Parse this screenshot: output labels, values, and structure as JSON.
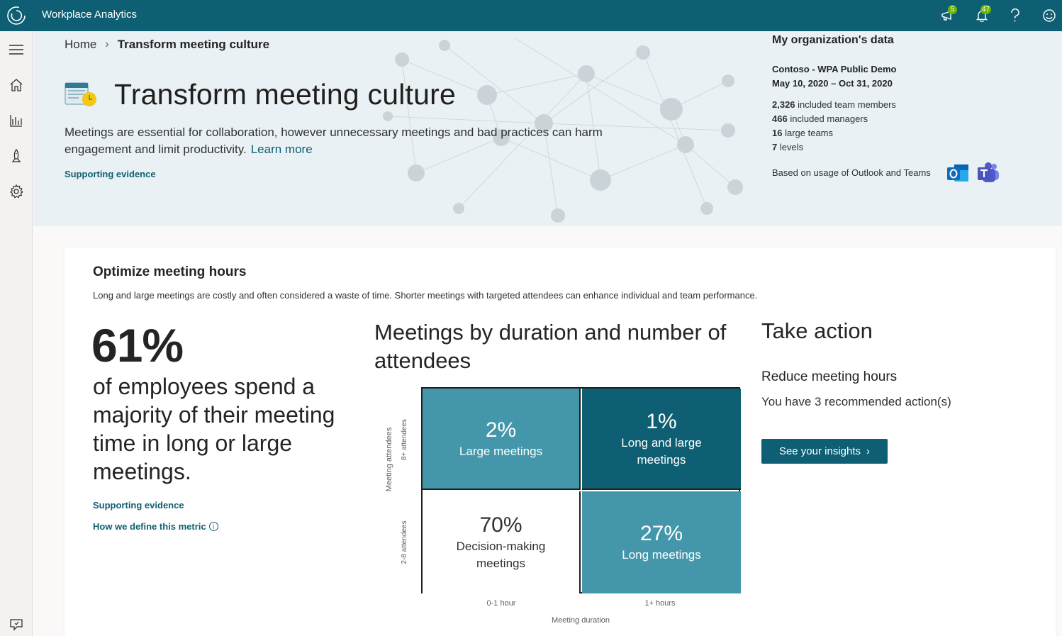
{
  "app": {
    "title": "Workplace Analytics",
    "accent_color": "#0e5f73",
    "badges": {
      "announcements": "5",
      "notifications": "47"
    }
  },
  "breadcrumb": {
    "home": "Home",
    "current": "Transform meeting culture"
  },
  "hero": {
    "title": "Transform meeting culture",
    "description": "Meetings are essential for collaboration, however unnecessary meetings and bad practices can harm engagement and limit productivity.",
    "learn_more": "Learn more",
    "supporting_evidence": "Supporting evidence"
  },
  "org": {
    "title": "My organization's data",
    "name": "Contoso - WPA Public Demo",
    "dates": "May 10, 2020 – Oct 31, 2020",
    "stats": [
      {
        "value": "2,326",
        "label": "included team members"
      },
      {
        "value": "466",
        "label": "included managers"
      },
      {
        "value": "16",
        "label": "large teams"
      },
      {
        "value": "7",
        "label": "levels"
      }
    ],
    "usage": "Based on usage of Outlook and Teams"
  },
  "card": {
    "title": "Optimize meeting hours",
    "description": "Long and large meetings are costly and often considered a waste of time. Shorter meetings with targeted attendees can enhance individual and team performance.",
    "big_pct": "61%",
    "big_text": "of employees spend a majority of their meeting time in long or large meetings.",
    "supporting_evidence": "Supporting evidence",
    "define_metric": "How we define this metric"
  },
  "chart_data": {
    "type": "heatmap",
    "title": "Meetings by duration and number of attendees",
    "xlabel": "Meeting duration",
    "ylabel": "Meeting attendees",
    "x_categories": [
      "0-1 hour",
      "1+ hours"
    ],
    "y_categories": [
      "8+ attendees",
      "2-8 attendees"
    ],
    "cells": [
      {
        "x": "0-1 hour",
        "y": "8+ attendees",
        "value": 2,
        "display": "2%",
        "label": "Large meetings"
      },
      {
        "x": "1+ hours",
        "y": "8+ attendees",
        "value": 1,
        "display": "1%",
        "label": "Long and large meetings"
      },
      {
        "x": "0-1 hour",
        "y": "2-8 attendees",
        "value": 70,
        "display": "70%",
        "label": "Decision-making meetings"
      },
      {
        "x": "1+ hours",
        "y": "2-8 attendees",
        "value": 27,
        "display": "27%",
        "label": "Long meetings"
      }
    ]
  },
  "take_action": {
    "title": "Take action",
    "subtitle": "Reduce meeting hours",
    "description": "You have 3 recommended action(s)",
    "button": "See your insights"
  }
}
